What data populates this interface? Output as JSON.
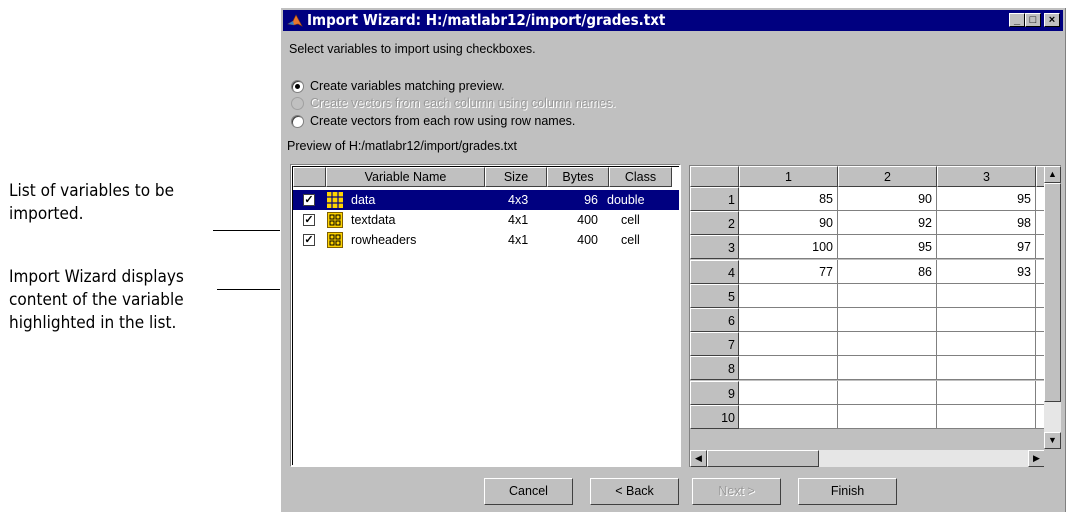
{
  "annotations": {
    "list_note": [
      "List of variables to be",
      "imported."
    ],
    "content_note": [
      "Import Wizard displays",
      "content of the variable",
      "highlighted in the list."
    ]
  },
  "window": {
    "title": "Import Wizard: H:/matlabr12/import/grades.txt",
    "controls": {
      "minimize": "_",
      "maximize": "□",
      "close": "×"
    }
  },
  "instructions": "Select variables to import using checkboxes.",
  "options": [
    {
      "label": "Create variables matching preview.",
      "selected": true,
      "enabled": true
    },
    {
      "label": "Create vectors from each column using column names.",
      "selected": false,
      "enabled": false
    },
    {
      "label": "Create vectors from each row using row names.",
      "selected": false,
      "enabled": true
    }
  ],
  "preview_label": "Preview of H:/matlabr12/import/grades.txt",
  "variable_list": {
    "columns": [
      "Variable Name",
      "Size",
      "Bytes",
      "Class"
    ],
    "rows": [
      {
        "checked": true,
        "icon": "matrix-icon",
        "name": "data",
        "size": "4x3",
        "bytes": "96",
        "class": "double",
        "highlighted": true
      },
      {
        "checked": true,
        "icon": "cell-icon",
        "name": "textdata",
        "size": "4x1",
        "bytes": "400",
        "class": "cell",
        "highlighted": false
      },
      {
        "checked": true,
        "icon": "cell-icon",
        "name": "rowheaders",
        "size": "4x1",
        "bytes": "400",
        "class": "cell",
        "highlighted": false
      }
    ]
  },
  "preview_grid": {
    "column_headers": [
      "1",
      "2",
      "3"
    ],
    "row_headers": [
      "1",
      "2",
      "3",
      "4",
      "5",
      "6",
      "7",
      "8",
      "9",
      "10"
    ],
    "cells": [
      [
        "85",
        "90",
        "95"
      ],
      [
        "90",
        "92",
        "98"
      ],
      [
        "100",
        "95",
        "97"
      ],
      [
        "77",
        "86",
        "93"
      ],
      [
        "",
        "",
        ""
      ],
      [
        "",
        "",
        ""
      ],
      [
        "",
        "",
        ""
      ],
      [
        "",
        "",
        ""
      ],
      [
        "",
        "",
        ""
      ],
      [
        "",
        "",
        ""
      ]
    ]
  },
  "buttons": {
    "cancel": "Cancel",
    "back": "< Back",
    "next": "Next >",
    "finish": "Finish"
  },
  "colors": {
    "title_bar": "#000080",
    "highlight": "#000080",
    "face": "#c0c0c0",
    "disabled_text": "#9a9a9a",
    "matrix_icon": "#ffd400"
  }
}
